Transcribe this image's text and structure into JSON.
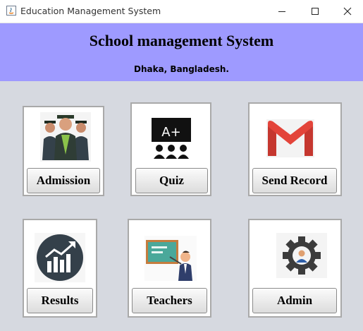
{
  "window": {
    "title": "Education Management System",
    "controls": {
      "minimize": "—",
      "maximize": "☐",
      "close": "✕"
    }
  },
  "header": {
    "title": "School management System",
    "subtitle": "Dhaka, Bangladesh.",
    "background": "#9e9aff"
  },
  "colors": {
    "body_background": "#d6d9e0",
    "card_border": "#a9a9a9",
    "button_border": "#8a8a8a"
  },
  "cards": [
    {
      "id": "admission",
      "label": "Admission",
      "icon": "graduates-icon"
    },
    {
      "id": "quiz",
      "label": "Quiz",
      "icon": "blackboard-grade-icon",
      "icon_text": "A+"
    },
    {
      "id": "send-record",
      "label": "Send Record",
      "icon": "gmail-icon"
    },
    {
      "id": "results",
      "label": "Results",
      "icon": "growth-chart-icon"
    },
    {
      "id": "teachers",
      "label": "Teachers",
      "icon": "teacher-board-icon"
    },
    {
      "id": "admin",
      "label": "Admin",
      "icon": "admin-gear-icon"
    }
  ]
}
